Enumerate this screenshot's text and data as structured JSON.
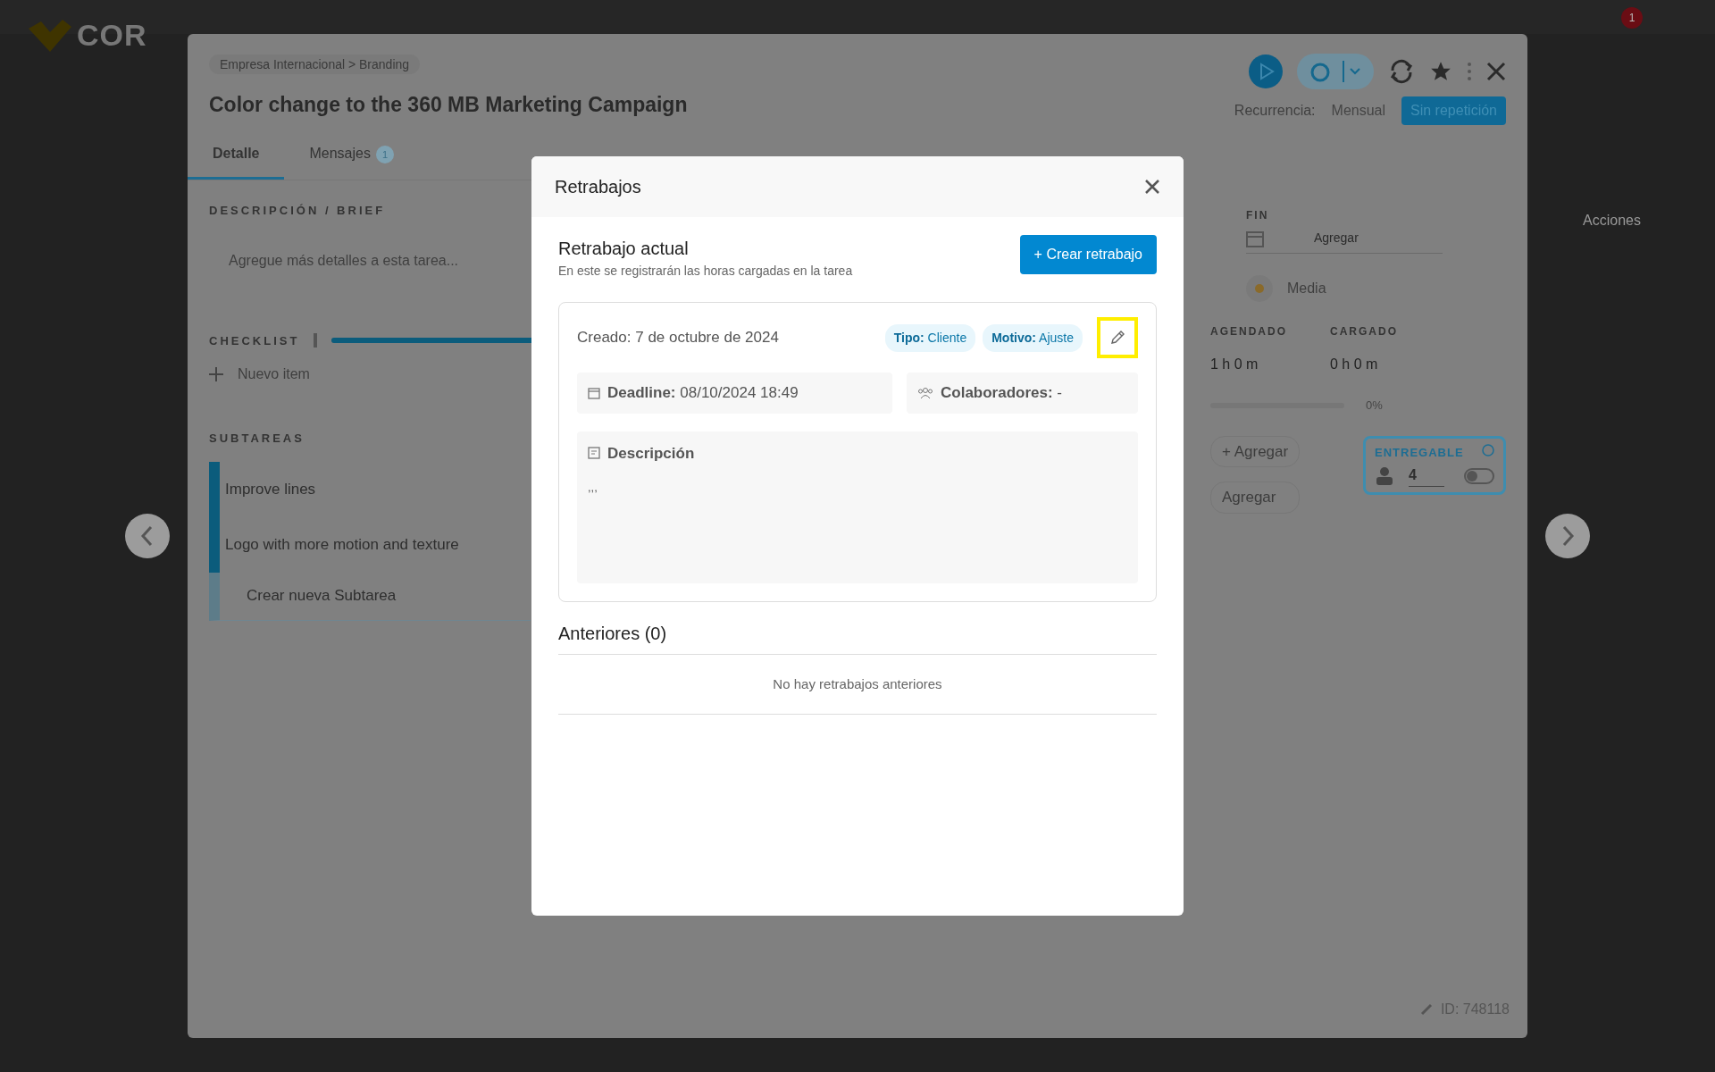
{
  "app": {
    "logo": "COR",
    "notification_count": "1",
    "side_label": "Acciones"
  },
  "task": {
    "breadcrumb": "Empresa Internacional  >  Branding",
    "title": "Color change to the 360 MB Marketing Campaign",
    "tabs": [
      {
        "label": "Detalle",
        "selected": true
      },
      {
        "label": "Mensajes",
        "count": "1",
        "selected": false
      }
    ],
    "recurrence": {
      "label": "Recurrencia:",
      "options": [
        {
          "label": "Mensual",
          "selected": false
        },
        {
          "label": "Sin repetición",
          "selected": true
        }
      ]
    },
    "description": {
      "label": "DESCRIPCIÓN / BRIEF",
      "placeholder": "Agregue más detalles a esta tarea..."
    },
    "checklist": {
      "label": "CHECKLIST",
      "level": 1,
      "new_item": "Nuevo item"
    },
    "subtasks": {
      "label": "SUBTAREAS",
      "items": [
        {
          "title": "Improve lines",
          "kind": "task"
        },
        {
          "title": "Logo with more motion and texture",
          "kind": "task"
        },
        {
          "title": "Crear nueva Subtarea",
          "kind": "new"
        }
      ]
    },
    "end": {
      "label": "FIN",
      "placeholder": "Agregar"
    },
    "priority": "Media",
    "times": [
      {
        "label": "AGENDADO",
        "value": "1 h 0 m"
      },
      {
        "label": "CARGADO",
        "value": "0 h 0 m"
      }
    ],
    "progress": {
      "level": 0,
      "reading": "0%"
    },
    "add_pills": [
      "+ Agregar",
      "Agregar"
    ],
    "deliverable": {
      "label": "ENTREGABLE",
      "count": "4",
      "on": false
    },
    "id": "ID: 748118"
  },
  "modal": {
    "title": "Retrabajos",
    "current": {
      "heading": "Retrabajo actual",
      "subtitle": "En este se registrarán las horas cargadas en la tarea",
      "create_button": "+ Crear retrabajo"
    },
    "rework": {
      "created": "Creado: 7 de octubre de 2024",
      "tags": [
        {
          "key": "Tipo:",
          "value": "Cliente"
        },
        {
          "key": "Motivo:",
          "value": "Ajuste"
        }
      ],
      "edit_highlighted": true,
      "deadline": {
        "label": "Deadline:",
        "value": "08/10/2024 18:49"
      },
      "collaborators": {
        "label": "Colaboradores:",
        "value": "-"
      },
      "description": {
        "label": "Descripción",
        "text": ",,,"
      }
    },
    "previous": {
      "heading": "Anteriores (0)",
      "empty": "No hay retrabajos anteriores"
    }
  }
}
